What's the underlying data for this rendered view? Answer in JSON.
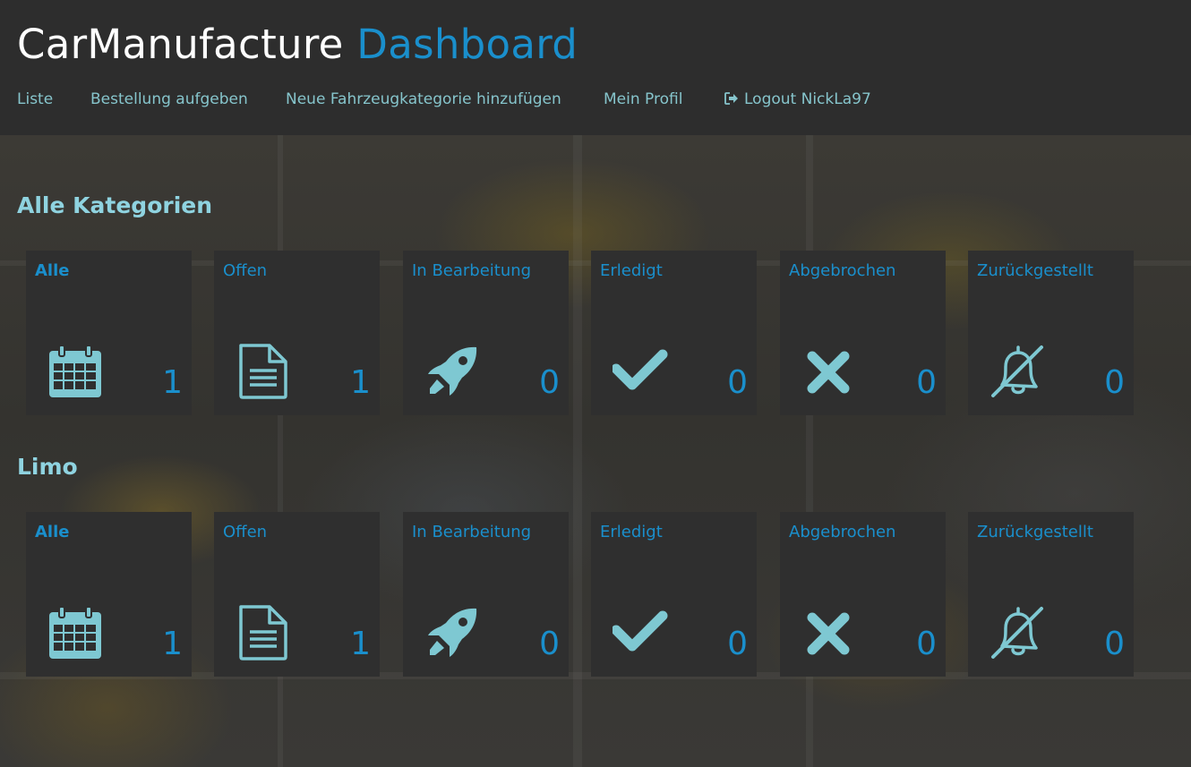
{
  "header": {
    "brand_main": "CarManufacture",
    "brand_accent": "Dashboard"
  },
  "nav": {
    "items": [
      {
        "label": "Liste"
      },
      {
        "label": "Bestellung aufgeben"
      },
      {
        "label": "Neue Fahrzeugkategorie hinzufügen"
      },
      {
        "label": "Mein Profil"
      },
      {
        "label": "Logout NickLa97",
        "icon": "sign-out-icon"
      }
    ]
  },
  "colors": {
    "accent": "#1a8fcc",
    "icon": "#7ec8d2",
    "card_bg": "#2f2f2f",
    "header_bg": "#2d2d2d"
  },
  "sections": [
    {
      "title": "Alle Kategorien",
      "cards": [
        {
          "label": "Alle",
          "icon": "calendar-icon",
          "count": "1"
        },
        {
          "label": "Offen",
          "icon": "document-icon",
          "count": "1"
        },
        {
          "label": "In Bearbeitung",
          "icon": "rocket-icon",
          "count": "0"
        },
        {
          "label": "Erledigt",
          "icon": "check-icon",
          "count": "0"
        },
        {
          "label": "Abgebrochen",
          "icon": "x-mark-icon",
          "count": "0"
        },
        {
          "label": "Zurückgestellt",
          "icon": "bell-slash-icon",
          "count": "0"
        }
      ]
    },
    {
      "title": "Limo",
      "cards": [
        {
          "label": "Alle",
          "icon": "calendar-icon",
          "count": "1"
        },
        {
          "label": "Offen",
          "icon": "document-icon",
          "count": "1"
        },
        {
          "label": "In Bearbeitung",
          "icon": "rocket-icon",
          "count": "0"
        },
        {
          "label": "Erledigt",
          "icon": "check-icon",
          "count": "0"
        },
        {
          "label": "Abgebrochen",
          "icon": "x-mark-icon",
          "count": "0"
        },
        {
          "label": "Zurückgestellt",
          "icon": "bell-slash-icon",
          "count": "0"
        }
      ]
    }
  ]
}
